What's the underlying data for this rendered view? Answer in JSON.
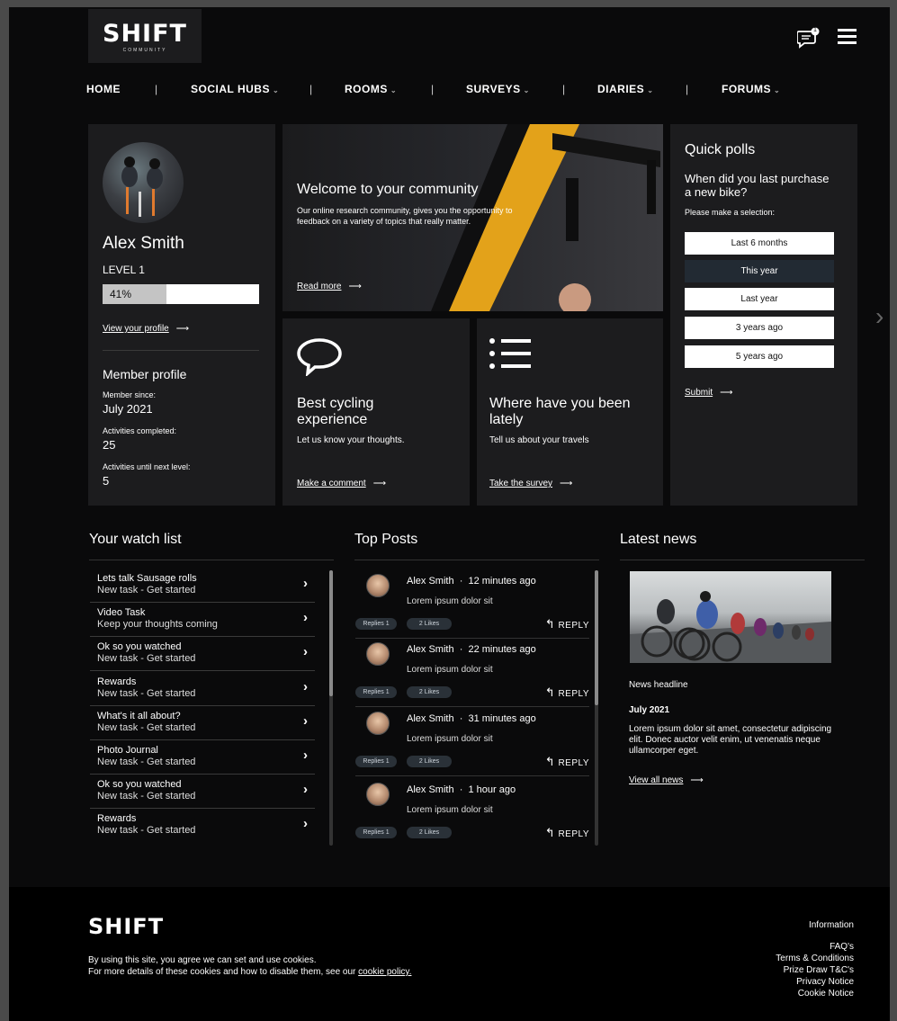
{
  "brand": {
    "name": "SHIFT",
    "tagline": "COMMUNITY"
  },
  "header": {
    "notification_count": "1"
  },
  "nav": [
    {
      "label": "HOME",
      "dropdown": false
    },
    {
      "label": "SOCIAL HUBS",
      "dropdown": true
    },
    {
      "label": "ROOMS",
      "dropdown": true
    },
    {
      "label": "SURVEYS",
      "dropdown": true
    },
    {
      "label": "DIARIES",
      "dropdown": true
    },
    {
      "label": "FORUMS",
      "dropdown": true
    }
  ],
  "profile": {
    "name": "Alex Smith",
    "level": "LEVEL 1",
    "progress_label": "41%",
    "progress_fraction": 0.41,
    "view_profile": "View your profile",
    "member_profile_title": "Member profile",
    "member_since_label": "Member since:",
    "member_since": "July 2021",
    "completed_label": "Activities completed:",
    "completed": "25",
    "next_level_label": "Activities until next level:",
    "next_level": "5"
  },
  "welcome": {
    "title": "Welcome to your community",
    "body": "Our online research community, gives you the opportunity to feedback on a variety of topics that really matter.",
    "link": "Read more"
  },
  "cards": [
    {
      "icon": "speech-bubble-icon",
      "title": "Best cycling experience",
      "body": "Let us know your thoughts.",
      "link": "Make a comment"
    },
    {
      "icon": "list-icon",
      "title": "Where have you been lately",
      "body": "Tell us about your travels",
      "link": "Take the survey"
    }
  ],
  "poll": {
    "title": "Quick polls",
    "question": "When did you last purchase a new bike?",
    "instruction": "Please make a selection:",
    "options": [
      "Last 6 months",
      "This year",
      "Last year",
      "3 years ago",
      "5 years ago"
    ],
    "selected_index": 1,
    "submit": "Submit"
  },
  "watchlist": {
    "title": "Your watch list",
    "items": [
      {
        "title": "Lets talk Sausage rolls",
        "sub": "New task - Get started"
      },
      {
        "title": "Video Task",
        "sub": "Keep your thoughts coming"
      },
      {
        "title": "Ok so you watched",
        "sub": "New task - Get started"
      },
      {
        "title": "Rewards",
        "sub": "New task - Get started"
      },
      {
        "title": "What's it all about?",
        "sub": "New task - Get started"
      },
      {
        "title": "Photo Journal",
        "sub": "New task - Get started"
      },
      {
        "title": "Ok so you watched",
        "sub": "New task - Get started"
      },
      {
        "title": "Rewards",
        "sub": "New task - Get started"
      }
    ]
  },
  "top_posts": {
    "title": "Top Posts",
    "reply_label": "REPLY",
    "items": [
      {
        "author": "Alex Smith",
        "time": "12 minutes ago",
        "body": "Lorem ipsum dolor sit",
        "replies": "Replies 1",
        "likes": "2 Likes"
      },
      {
        "author": "Alex Smith",
        "time": "22 minutes ago",
        "body": "Lorem ipsum dolor sit",
        "replies": "Replies 1",
        "likes": "2 Likes"
      },
      {
        "author": "Alex Smith",
        "time": "31 minutes ago",
        "body": "Lorem ipsum dolor sit",
        "replies": "Replies 1",
        "likes": "2 Likes"
      },
      {
        "author": "Alex Smith",
        "time": "1 hour ago",
        "body": "Lorem ipsum dolor sit",
        "replies": "Replies 1",
        "likes": "2 Likes"
      }
    ]
  },
  "news": {
    "title": "Latest news",
    "headline": "News headline",
    "date": "July 2021",
    "body": "Lorem ipsum dolor sit amet, consectetur adipiscing elit. Donec auctor velit enim, ut venenatis neque ullamcorper eget.",
    "link": "View all news"
  },
  "footer": {
    "logo": "SHIFT",
    "cookie_line1": "By using this site, you agree we can set and use cookies.",
    "cookie_line2": "For more details of these cookies and how to disable them, see our",
    "cookie_link": "cookie policy.",
    "info_title": "Information",
    "links": [
      "FAQ's",
      "Terms & Conditions",
      "Prize Draw T&C's",
      "Privacy Notice",
      "Cookie Notice"
    ]
  }
}
